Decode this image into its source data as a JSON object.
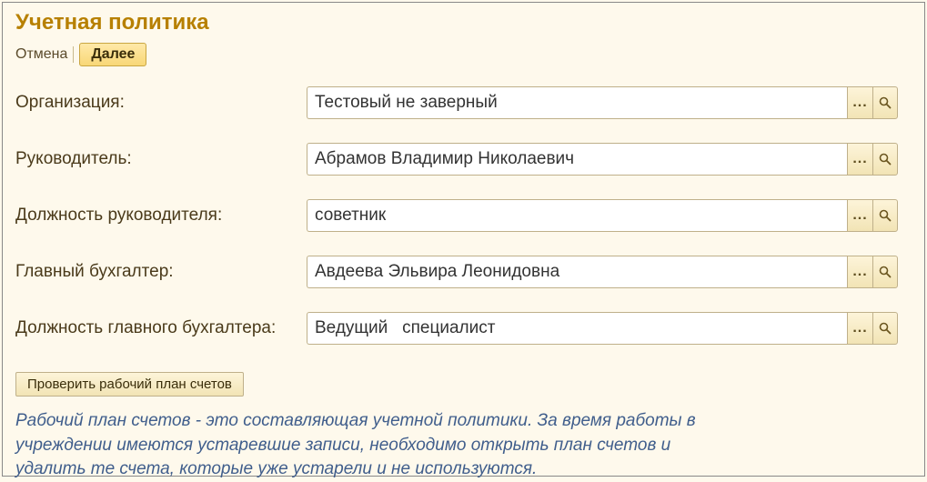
{
  "page_title": "Учетная политика",
  "toolbar": {
    "cancel_label": "Отмена",
    "next_label": "Далее"
  },
  "fields": {
    "organization": {
      "label": "Организация:",
      "value": "Тестовый не заверный"
    },
    "head": {
      "label": "Руководитель:",
      "value": "Абрамов Владимир Николаевич"
    },
    "head_position": {
      "label": "Должность руководителя:",
      "value": "советник"
    },
    "chief_accountant": {
      "label": "Главный бухгалтер:",
      "value": "Авдеева Эльвира Леонидовна"
    },
    "chief_accountant_position": {
      "label": "Должность главного бухгалтера:",
      "value": "Ведущий   специалист"
    }
  },
  "check_plan_label": "Проверить рабочий план счетов",
  "hint": "Рабочий план счетов - это составляющая учетной политики. За время работы в учреждении имеются устаревшие записи, необходимо открыть план счетов и удалить те счета, которые уже устарели и не используются.",
  "icons": {
    "ellipsis": "...",
    "search": "search"
  }
}
